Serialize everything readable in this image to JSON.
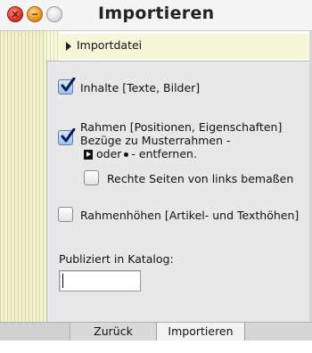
{
  "window": {
    "title": "Importieren"
  },
  "import_file": {
    "label": "Importdatei"
  },
  "options": {
    "contents": {
      "label": "Inhalte [Texte, Bilder]",
      "checked": true
    },
    "frames": {
      "line1": "Rahmen [Positionen, Eigenschaften]",
      "line2": "Bezüge zu Musterrahmen -",
      "line3_mid": "oder",
      "line3_end": "- entfernen.",
      "checked": true
    },
    "right_pages": {
      "label": "Rechte Seiten von links bemaßen",
      "checked": false
    },
    "frame_heights": {
      "label": "Rahmenhöhen [Artikel- und Texthöhen]",
      "checked": false
    }
  },
  "catalog": {
    "label": "Publiziert in Katalog:",
    "value": ""
  },
  "buttons": {
    "back": "Zurück",
    "import": "Importieren"
  },
  "icons": {
    "close": "close-icon",
    "minimize": "minimize-icon",
    "zoom": "zoom-icon",
    "disclosure": "disclosure-triangle-icon",
    "arrow": "arrow-box-icon",
    "bullet": "bullet-icon"
  }
}
